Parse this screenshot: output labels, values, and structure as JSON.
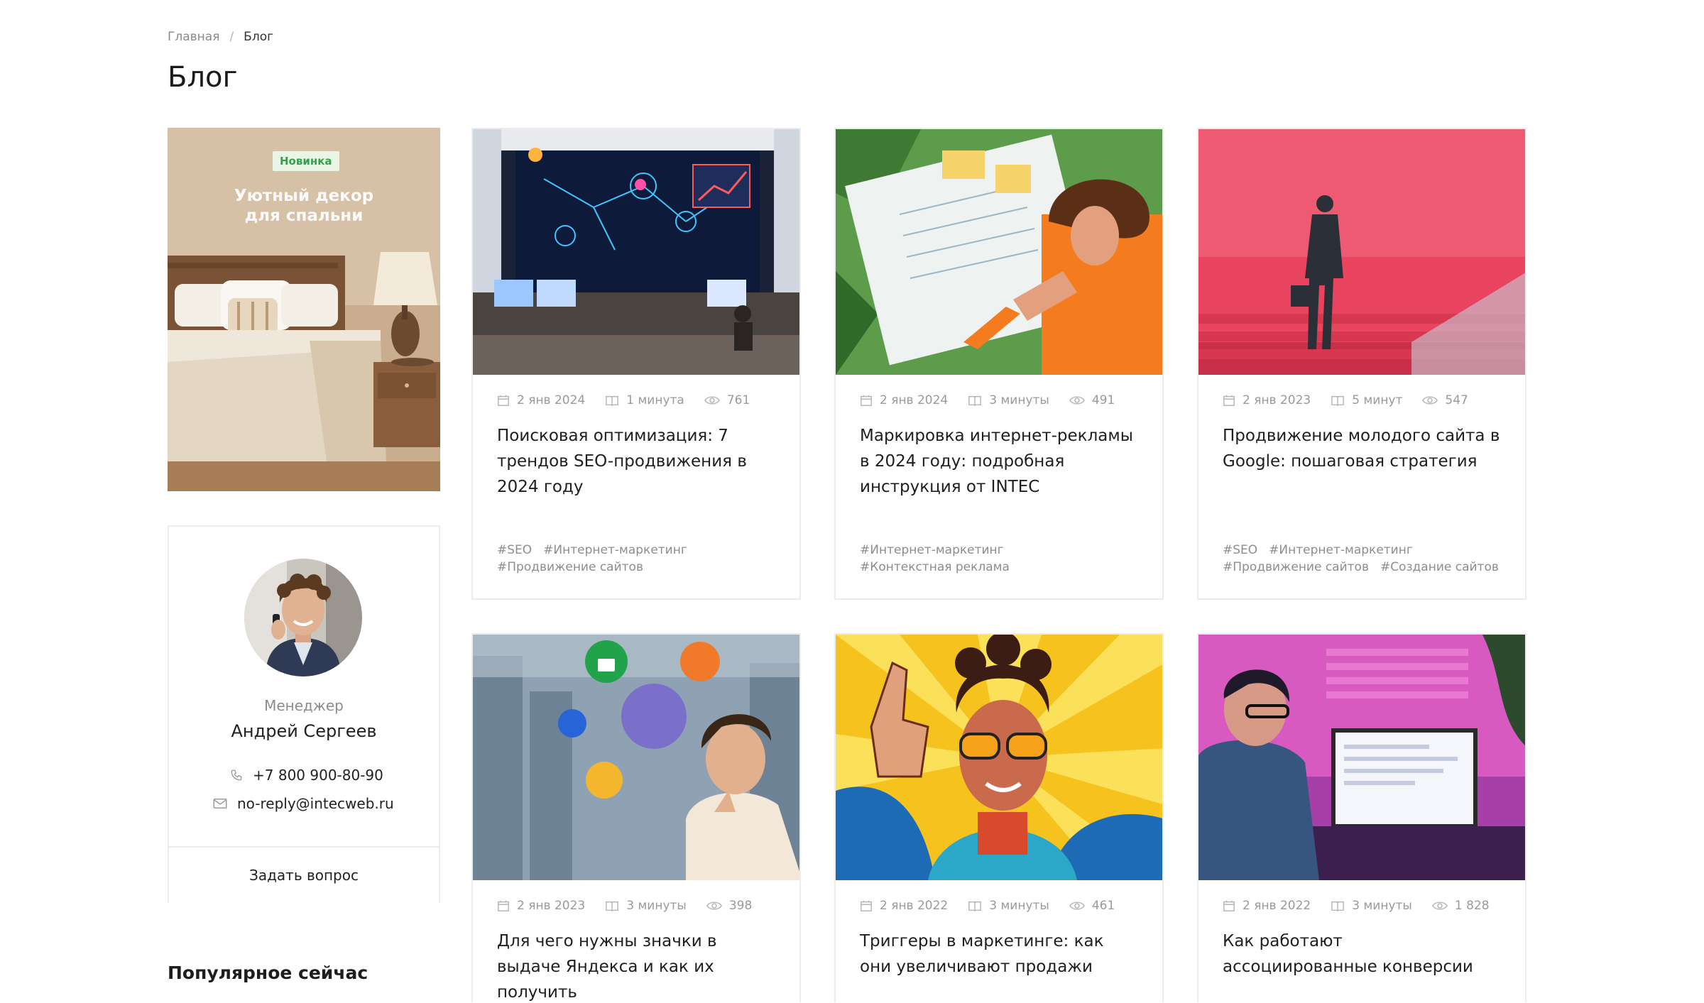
{
  "breadcrumb": {
    "home": "Главная",
    "separator": "/",
    "current": "Блог"
  },
  "page_title": "Блог",
  "promo": {
    "badge": "Новинка",
    "title_line1": "Уютный декор",
    "title_line2": "для спальни"
  },
  "manager": {
    "role": "Менеджер",
    "name": "Андрей Сергеев",
    "phone": "+7 800 900-80-90",
    "email": "no-reply@intecweb.ru",
    "ask_button": "Задать вопрос"
  },
  "popular_heading": "Популярное сейчас",
  "articles": [
    {
      "date": "2 янв 2024",
      "read_time": "1 минута",
      "views": "761",
      "title": "Поисковая оптимизация: 7 трендов SEO-продвижения в 2024 году",
      "tags": [
        "#SEO",
        "#Интернет-маркетинг",
        "#Продвижение сайтов"
      ]
    },
    {
      "date": "2 янв 2024",
      "read_time": "3 минуты",
      "views": "491",
      "title": "Маркировка интернет-рекламы в 2024 году: подробная инструкция от INTEC",
      "tags": [
        "#Интернет-маркетинг",
        "#Контекстная реклама"
      ]
    },
    {
      "date": "2 янв 2023",
      "read_time": "5 минут",
      "views": "547",
      "title": "Продвижение молодого сайта в Google: пошаговая стратегия",
      "tags": [
        "#SEO",
        "#Интернет-маркетинг",
        "#Продвижение сайтов",
        "#Создание сайтов"
      ]
    },
    {
      "date": "2 янв 2023",
      "read_time": "3 минуты",
      "views": "398",
      "title": "Для чего нужны значки в выдаче Яндекса и как их получить",
      "tags": []
    },
    {
      "date": "2 янв 2022",
      "read_time": "3 минуты",
      "views": "461",
      "title": "Триггеры в маркетинге: как они увеличивают продажи",
      "tags": []
    },
    {
      "date": "2 янв 2022",
      "read_time": "3 минуты",
      "views": "1 828",
      "title": "Как работают ассоциированные конверсии",
      "tags": []
    }
  ],
  "icons": {
    "date": "calendar-icon",
    "read_time": "book-icon",
    "views": "eye-icon",
    "phone": "phone-icon",
    "email": "mail-icon"
  },
  "colors": {
    "badge_bg": "#e9f6e6",
    "badge_text": "#33a04a",
    "border": "#ececec",
    "meta_text": "#9a9a9a"
  }
}
